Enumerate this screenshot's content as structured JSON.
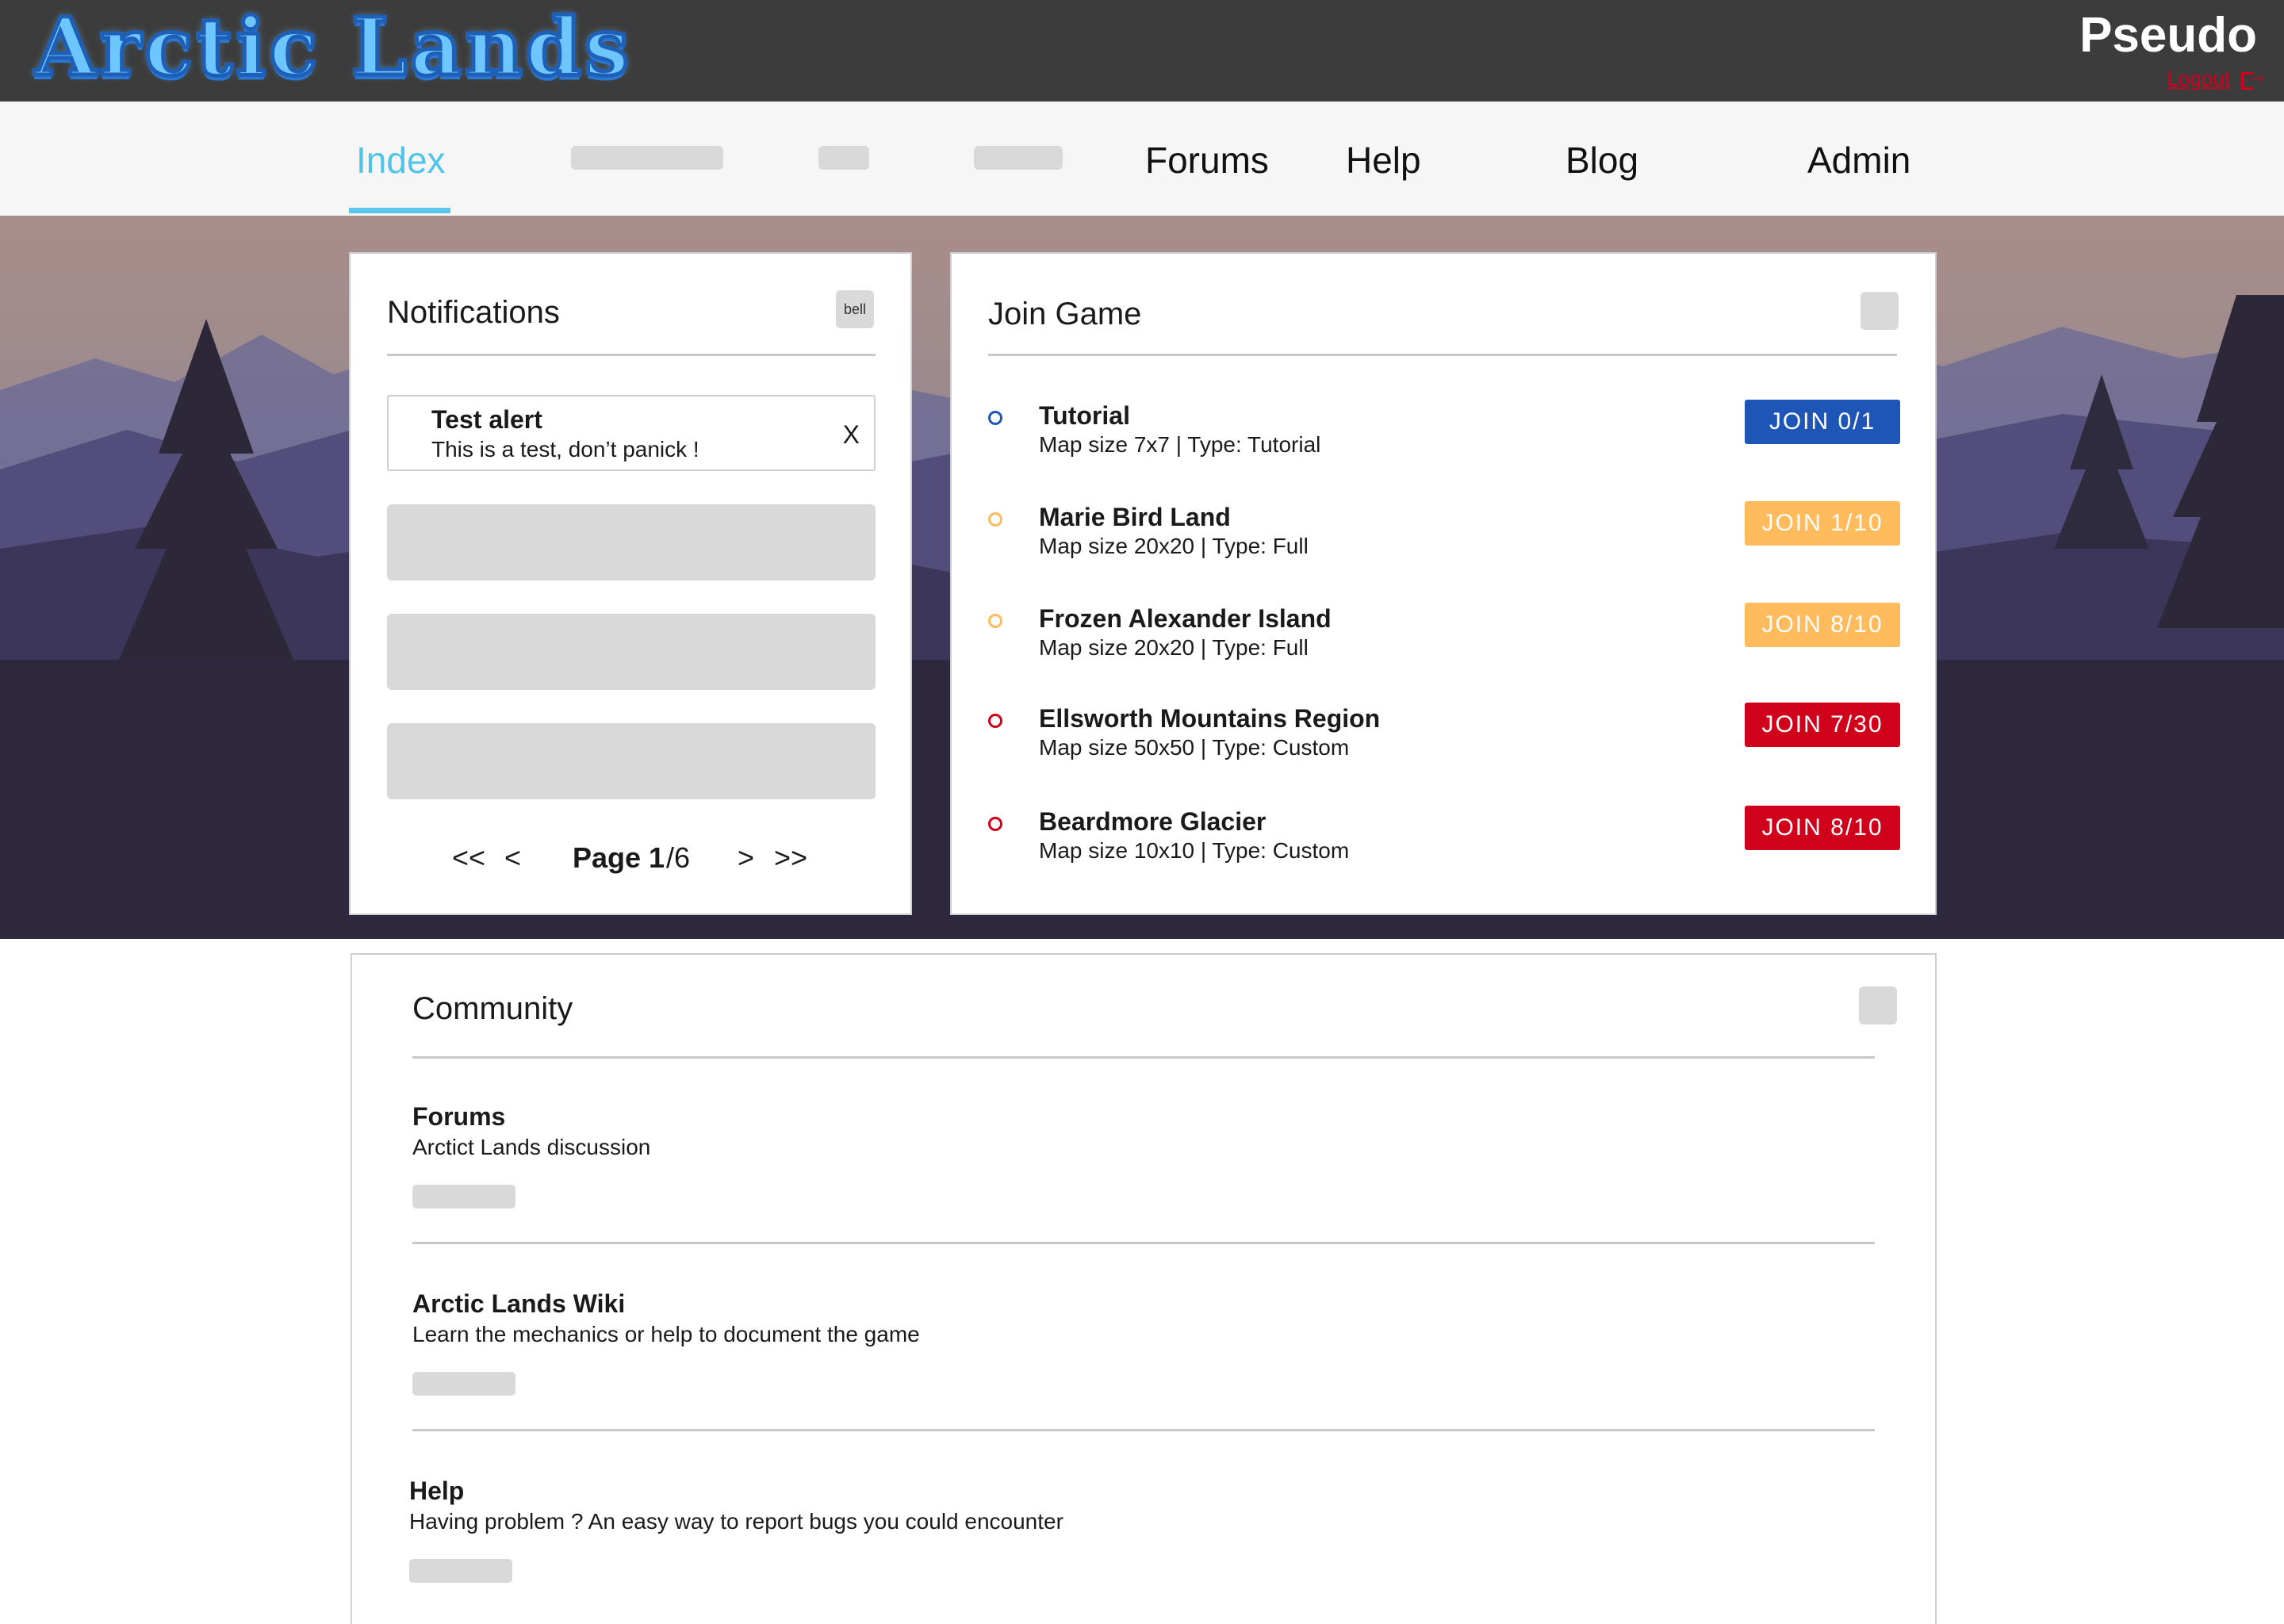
{
  "header": {
    "logo_text": "Arctic Lands",
    "username": "Pseudo",
    "logout_label": "Logout"
  },
  "nav": {
    "items": [
      {
        "label": "Index",
        "active": true
      },
      {
        "label": "Forums"
      },
      {
        "label": "Help"
      },
      {
        "label": "Blog"
      },
      {
        "label": "Admin"
      }
    ]
  },
  "notifications": {
    "title": "Notifications",
    "bell_label": "bell",
    "alert": {
      "title": "Test alert",
      "text": "This is a test, don’t panick !",
      "close": "X"
    },
    "pager": {
      "first": "<<",
      "prev": "<",
      "page_word": "Page",
      "current": "1",
      "total": "/6",
      "next": ">",
      "last": ">>"
    }
  },
  "join_game": {
    "title": "Join Game",
    "games": [
      {
        "name": "Tutorial",
        "info": "Map size 7x7 | Type: Tutorial",
        "button": "JOIN 0/1",
        "color": "#1e56b8"
      },
      {
        "name": "Marie Bird Land",
        "info": "Map size 20x20 | Type: Full",
        "button": "JOIN 1/10",
        "color": "#ffbb5c"
      },
      {
        "name": "Frozen Alexander Island",
        "info": "Map size 20x20 | Type: Full",
        "button": "JOIN 8/10",
        "color": "#ffbb5c"
      },
      {
        "name": "Ellsworth Mountains Region",
        "info": "Map size 50x50 | Type: Custom",
        "button": "JOIN 7/30",
        "color": "#d0021b"
      },
      {
        "name": "Beardmore Glacier",
        "info": "Map size 10x10 | Type: Custom",
        "button": "JOIN 8/10",
        "color": "#d0021b"
      }
    ]
  },
  "community": {
    "title": "Community",
    "items": [
      {
        "title": "Forums",
        "desc": "Arctict Lands discussion"
      },
      {
        "title": "Arctic Lands Wiki",
        "desc": "Learn the mechanics or help to document the game"
      },
      {
        "title": "Help",
        "desc": "Having problem ? An easy way to report bugs you could encounter"
      }
    ]
  },
  "colors": {
    "accent": "#4fc3e8",
    "topbar": "#3c3c3c",
    "danger": "#d0021b"
  }
}
